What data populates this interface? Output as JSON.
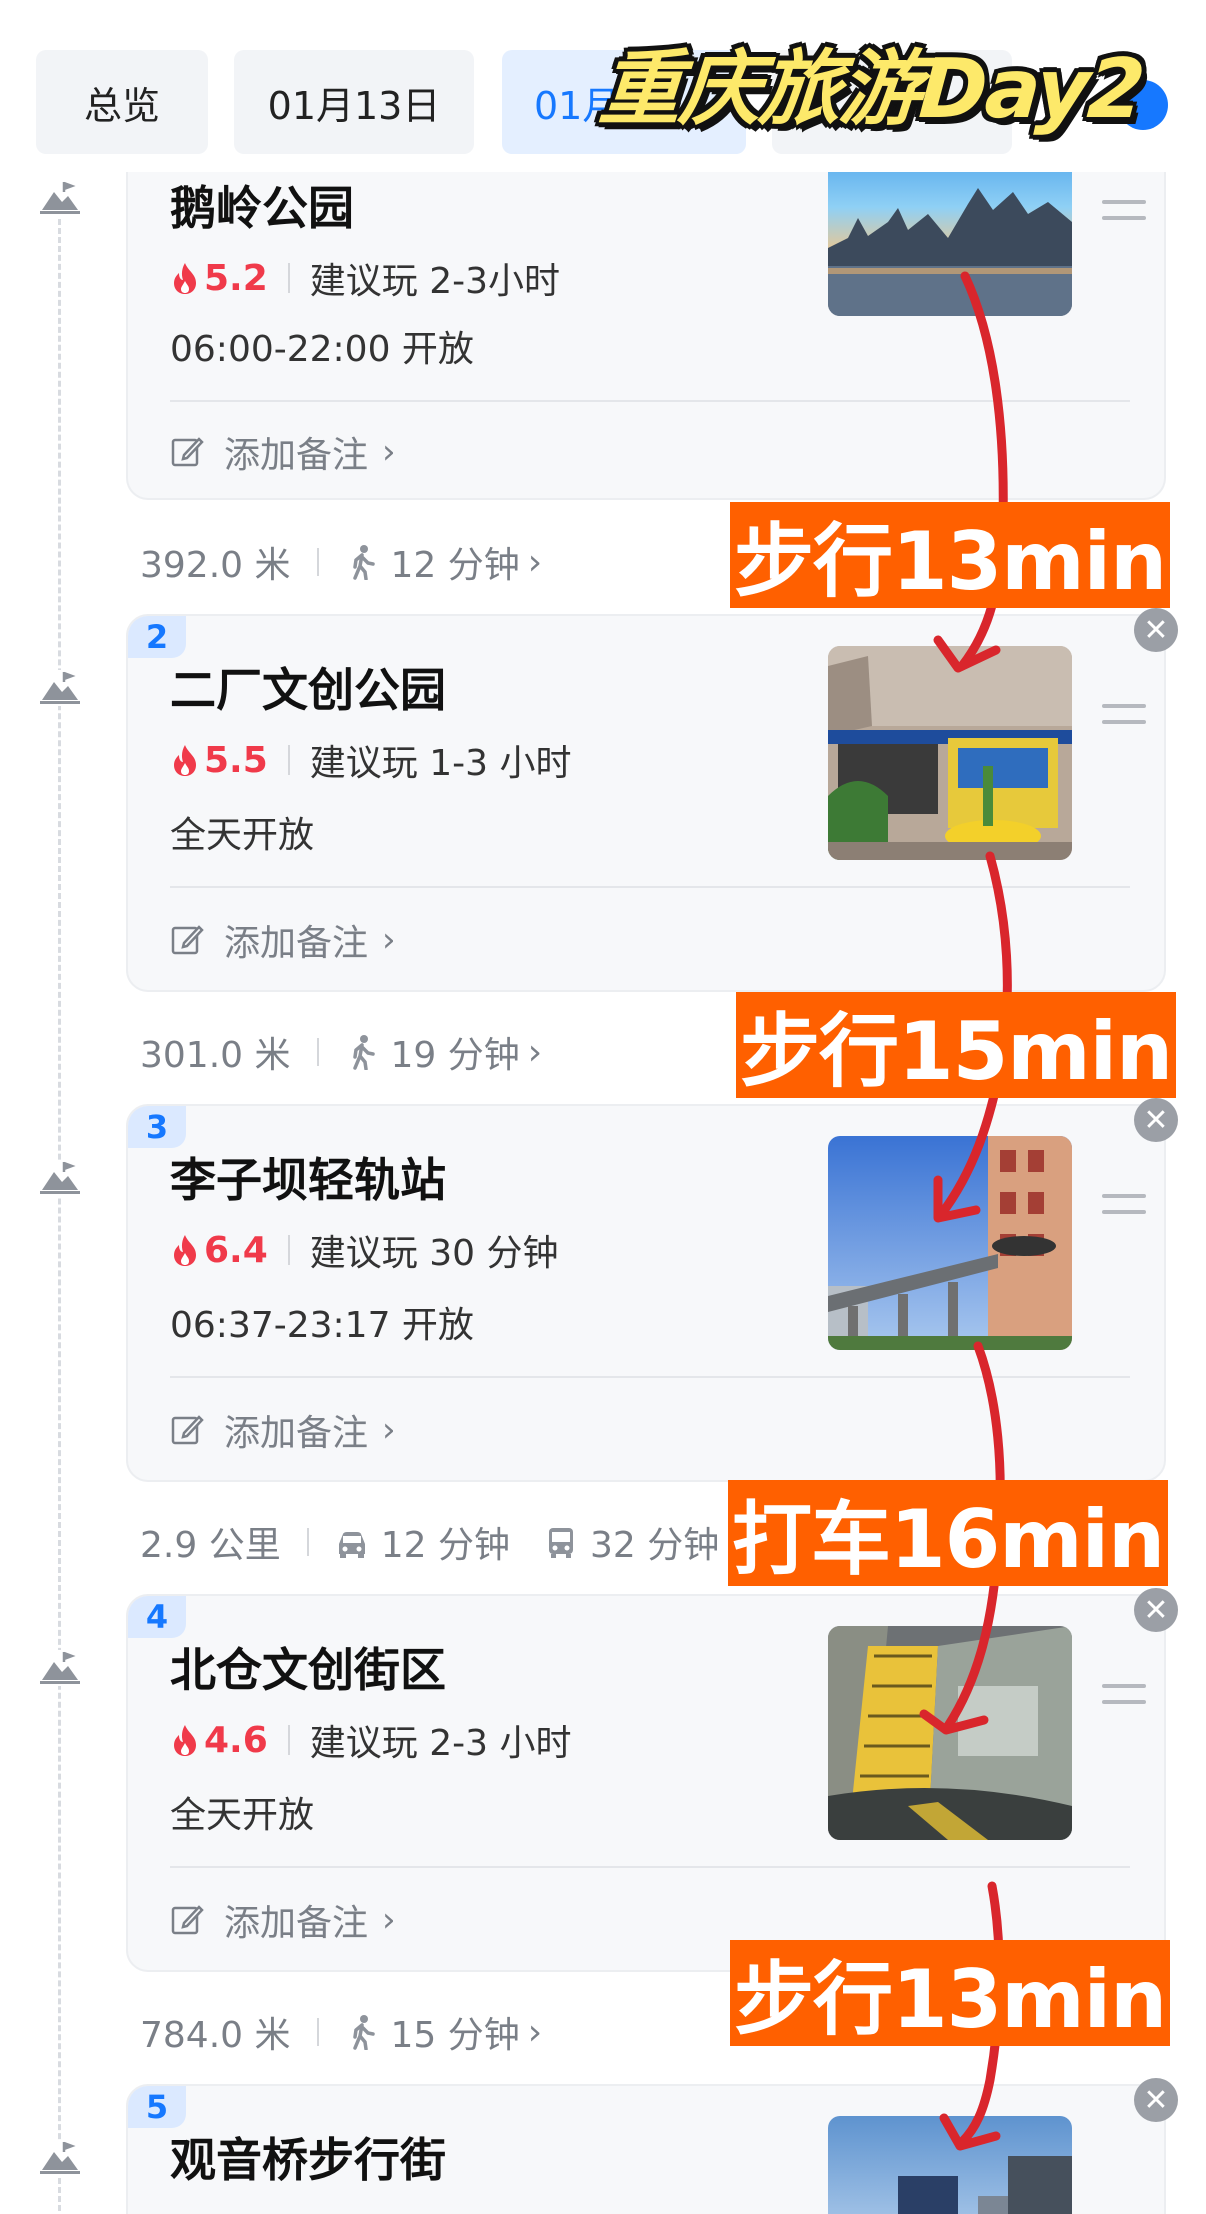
{
  "tabs": {
    "overview": "总览",
    "day1": "01月13日",
    "day2": "01月"
  },
  "overlay_title": "重庆旅游Day2",
  "pois": [
    {
      "index": "",
      "name": "鹅岭公园",
      "heat": "5.2",
      "duration": "建议玩 2-3小时",
      "hours": "06:00-22:00 开放",
      "note": "添加备注"
    },
    {
      "index": "2",
      "name": "二厂文创公园",
      "heat": "5.5",
      "duration": "建议玩 1-3 小时",
      "hours": "全天开放",
      "note": "添加备注"
    },
    {
      "index": "3",
      "name": "李子坝轻轨站",
      "heat": "6.4",
      "duration": "建议玩 30 分钟",
      "hours": "06:37-23:17 开放",
      "note": "添加备注"
    },
    {
      "index": "4",
      "name": "北仓文创街区",
      "heat": "4.6",
      "duration": "建议玩 2-3 小时",
      "hours": "全天开放",
      "note": "添加备注"
    },
    {
      "index": "5",
      "name": "观音桥步行街"
    }
  ],
  "transits": [
    {
      "distance": "392.0 米",
      "walk": "12 分钟"
    },
    {
      "distance": "301.0 米",
      "walk": "19 分钟"
    },
    {
      "distance": "2.9 公里",
      "car": "12 分钟",
      "bus": "32 分钟"
    },
    {
      "distance": "784.0 米",
      "walk": "15 分钟"
    }
  ],
  "annotations": [
    "步行13min",
    "步行15min",
    "打车16min",
    "步行13min"
  ],
  "colors": {
    "accent_blue": "#1678ff",
    "heat_red": "#f03a4a",
    "annotation_orange": "#ff6000",
    "route_red": "#d9262c",
    "title_yellow": "#fde96a"
  },
  "icons": {
    "marker": "scenic-spot-icon",
    "heat": "flame-icon",
    "note": "edit-icon",
    "walk": "walking-icon",
    "car": "car-icon",
    "bus": "bus-icon",
    "drag": "drag-handle-icon",
    "close": "close-icon"
  }
}
